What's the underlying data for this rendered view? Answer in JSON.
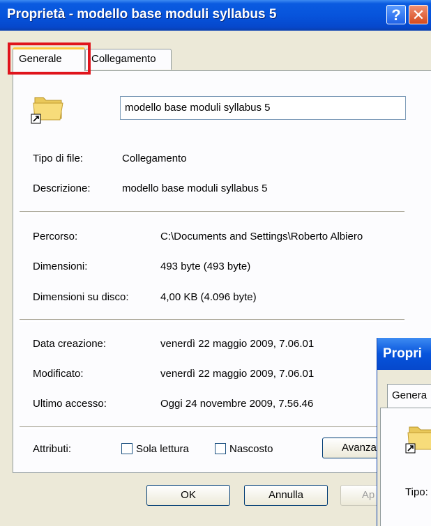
{
  "window": {
    "title": "Proprietà - modello base moduli syllabus 5",
    "help_label": "?",
    "close_label": "✕"
  },
  "tabs": [
    {
      "label": "Generale"
    },
    {
      "label": "Collegamento"
    }
  ],
  "general": {
    "name_value": "modello base moduli syllabus 5",
    "tipo_label": "Tipo di file:",
    "tipo_value": "Collegamento",
    "descrizione_label": "Descrizione:",
    "descrizione_value": "modello base moduli syllabus 5",
    "percorso_label": "Percorso:",
    "percorso_value": "C:\\Documents and Settings\\Roberto Albiero",
    "dimensioni_label": "Dimensioni:",
    "dimensioni_value": "493 byte (493 byte)",
    "dimdisco_label": "Dimensioni su disco:",
    "dimdisco_value": "4,00 KB (4.096 byte)",
    "creazione_label": "Data creazione:",
    "creazione_value": "venerdì 22 maggio 2009, 7.06.01",
    "modificato_label": "Modificato:",
    "modificato_value": "venerdì 22 maggio 2009, 7.06.01",
    "accesso_label": "Ultimo accesso:",
    "accesso_value": "Oggi 24 novembre 2009, 7.56.46",
    "attributi_label": "Attributi:",
    "sola_lettura_label": "Sola lettura",
    "nascosto_label": "Nascosto",
    "avanzate_label": "Avanzat"
  },
  "buttons": {
    "ok": "OK",
    "annulla": "Annulla",
    "applica": "Ap"
  },
  "second_window": {
    "title": "Propri",
    "tab_label": "Genera",
    "tipo_label": "Tipo:"
  }
}
